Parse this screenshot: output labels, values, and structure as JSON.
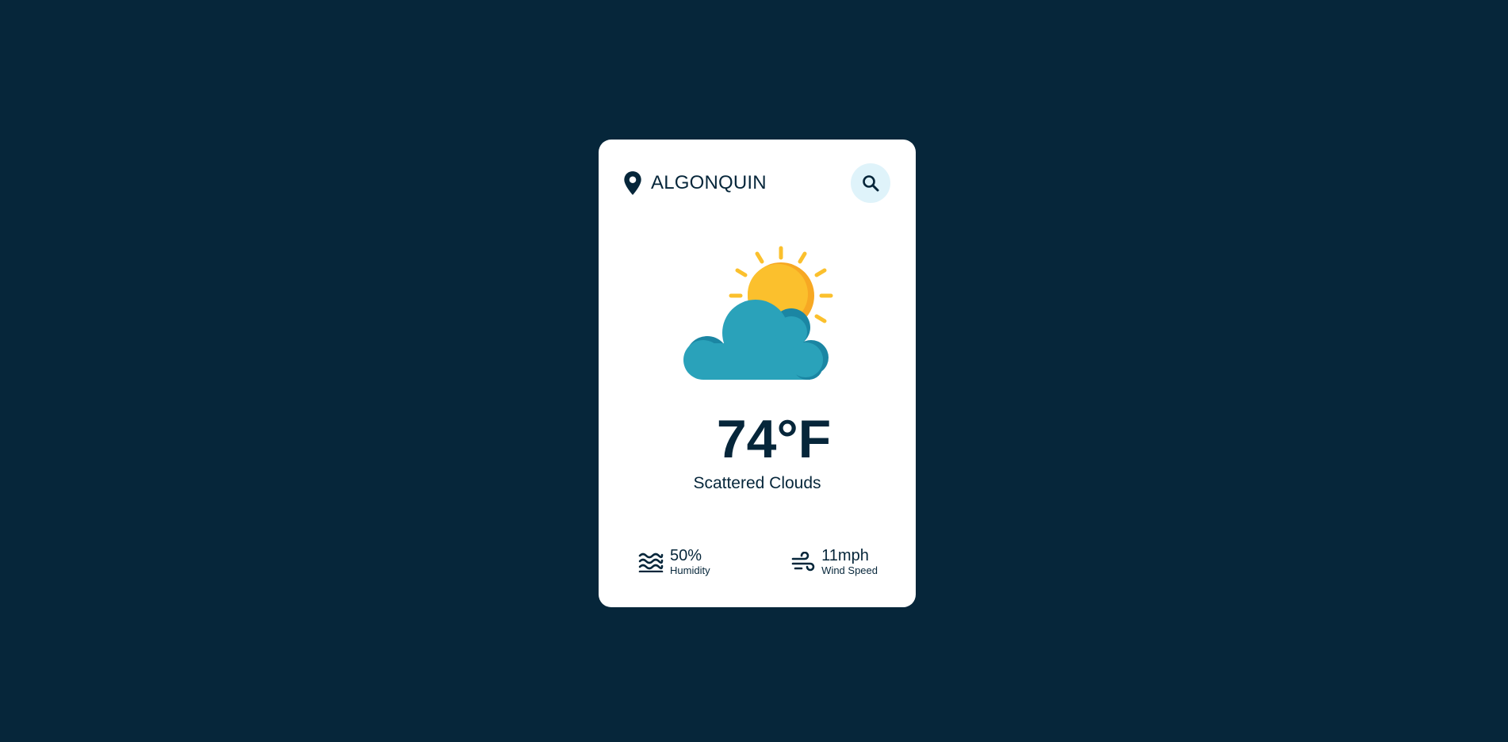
{
  "location": {
    "city": "ALGONQUIN",
    "icon": "map-pin-icon"
  },
  "search": {
    "icon": "search-icon",
    "button_color": "#dff3fa"
  },
  "weather": {
    "temperature": "74°F",
    "condition": "Scattered Clouds",
    "icon": "partly-cloudy-icon"
  },
  "stats": {
    "humidity": {
      "value": "50%",
      "label": "Humidity",
      "icon": "humidity-waves-icon"
    },
    "wind": {
      "value": "11mph",
      "label": "Wind Speed",
      "icon": "wind-icon"
    }
  },
  "colors": {
    "background": "#06263a",
    "card": "#ffffff",
    "text": "#06263a",
    "sun": "#fbc02d",
    "sun_shade": "#f7a823",
    "cloud": "#2aa2ba",
    "cloud_shade": "#1b86a3"
  }
}
